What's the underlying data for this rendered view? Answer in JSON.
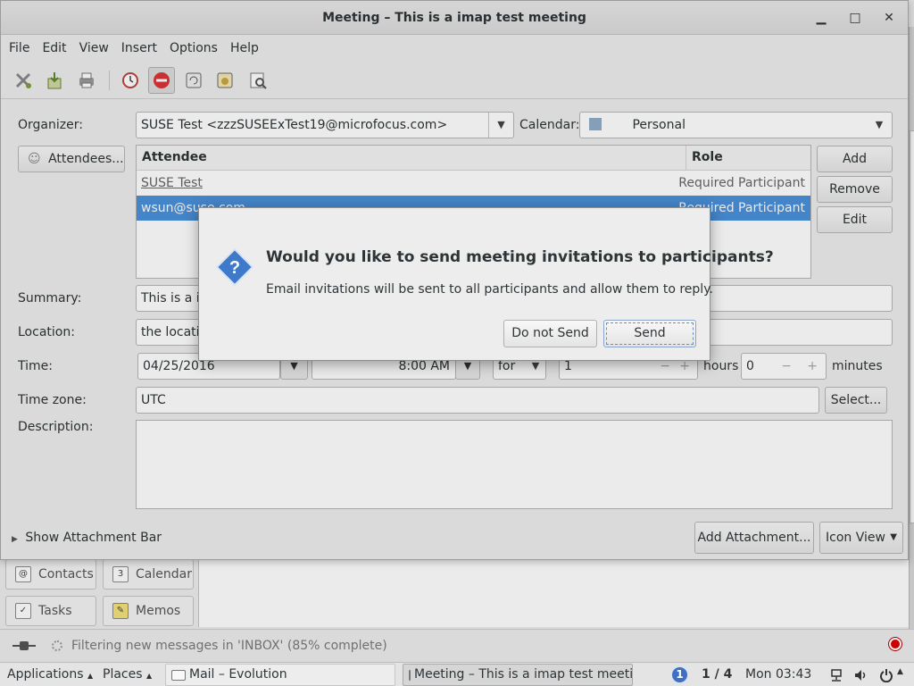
{
  "evolution": {
    "switcher": [
      {
        "label": "Contacts",
        "icon": "contacts-icon"
      },
      {
        "label": "Calendar",
        "icon": "calendar-icon"
      },
      {
        "label": "Tasks",
        "icon": "tasks-icon"
      },
      {
        "label": "Memos",
        "icon": "memos-icon"
      }
    ],
    "status_text": "Filtering new messages in 'INBOX' (85% complete)",
    "status_progress_percent": 85
  },
  "meeting": {
    "title": "Meeting – This is a imap test meeting",
    "menu": [
      "File",
      "Edit",
      "View",
      "Insert",
      "Options",
      "Help"
    ],
    "toolbar": [
      "close-icon",
      "save-icon",
      "print-icon",
      "clock-icon",
      "busy-icon",
      "recurrence-icon",
      "calendar-date-icon",
      "preview-icon"
    ],
    "organizer_label": "Organizer:",
    "organizer_value": "SUSE Test <zzzSUSEExTest19@microfocus.com>",
    "calendar_label": "Calendar:",
    "calendar_value": "Personal",
    "calendar_color": "#8faec8",
    "attendees_button": "Attendees...",
    "attendee_columns": {
      "attendee": "Attendee",
      "role": "Role"
    },
    "attendees": [
      {
        "name": "SUSE Test",
        "role": "Required Participant",
        "selected": false
      },
      {
        "name": "wsun@suse.com",
        "role": "Required Participant",
        "selected": true
      }
    ],
    "attendee_actions": {
      "add": "Add",
      "remove": "Remove",
      "edit": "Edit"
    },
    "summary_label": "Summary:",
    "summary_value": "This is a imap test meeting",
    "location_label": "Location:",
    "location_value": "the location",
    "time_label": "Time:",
    "time_date": "04/25/2016",
    "time_start": "8:00 AM",
    "time_for": "for",
    "duration_hours": "1",
    "hours_label": "hours",
    "duration_minutes": "0",
    "minutes_label": "minutes",
    "timezone_label": "Time zone:",
    "timezone_value": "UTC",
    "timezone_select": "Select...",
    "description_label": "Description:",
    "attachment_bar": "Show Attachment Bar",
    "add_attachment": "Add Attachment...",
    "icon_view": "Icon View"
  },
  "dialog": {
    "title": "Would you like to send meeting invitations to participants?",
    "text": "Email invitations will be sent to all participants and allow them to reply.",
    "do_not_send": "Do not Send",
    "send": "Send"
  },
  "taskbar": {
    "applications": "Applications",
    "places": "Places",
    "tasks": [
      {
        "label": "Mail – Evolution",
        "active": false
      },
      {
        "label": "Meeting – This is a imap test meeti...",
        "active": true
      }
    ],
    "workspace_badge": "1",
    "workspace": "1 / 4",
    "clock": "Mon 03:43"
  }
}
